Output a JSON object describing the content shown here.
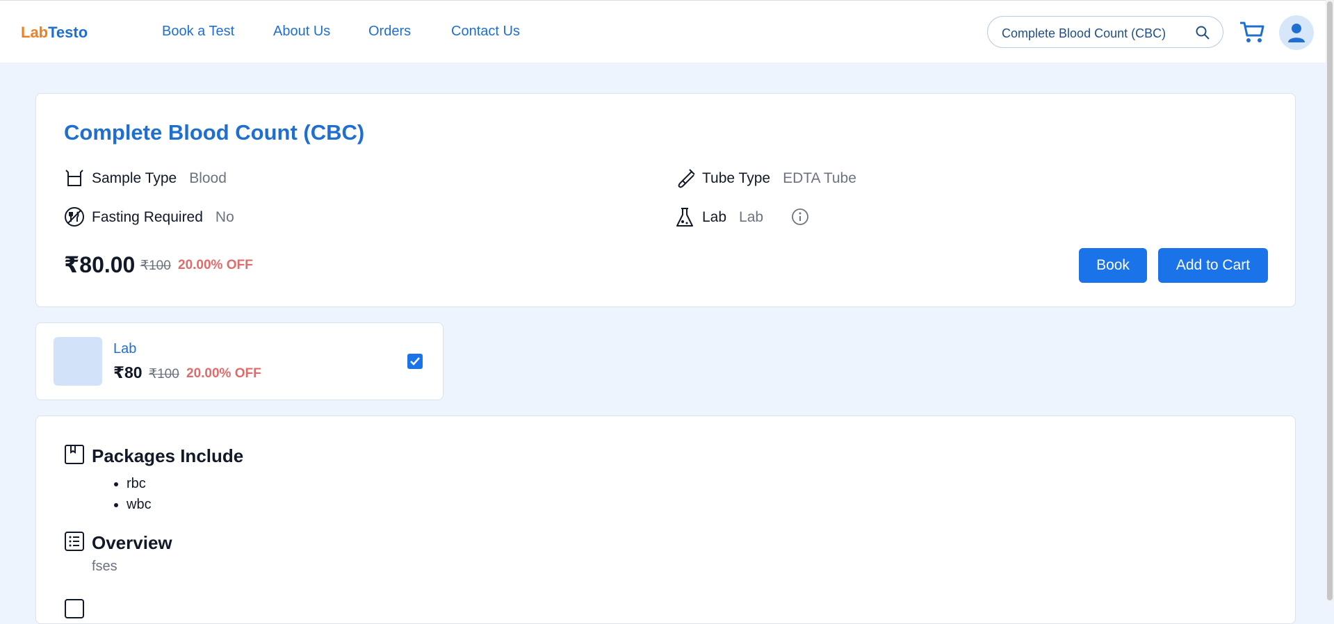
{
  "header": {
    "brand_part1": "Lab",
    "brand_part2": "Testo",
    "nav": [
      "Book a Test",
      "About Us",
      "Orders",
      "Contact Us"
    ],
    "search_value": "Complete Blood Count (CBC)",
    "icons": [
      "search-icon",
      "cart-icon",
      "user-avatar-icon"
    ]
  },
  "test": {
    "title": "Complete Blood Count (CBC)",
    "attributes": [
      {
        "key": "Sample Type",
        "value": "Blood",
        "icon": "sample-container-icon"
      },
      {
        "key": "Tube Type",
        "value": "EDTA Tube",
        "icon": "test-tube-icon"
      },
      {
        "key": "Fasting Required",
        "value": "No",
        "icon": "fasting-icon"
      },
      {
        "key": "Lab",
        "value": "Lab",
        "icon": "flask-icon"
      }
    ],
    "price": "₹80.00",
    "mrp": "₹100",
    "discount": "20.00% OFF",
    "book_label": "Book",
    "cart_label": "Add to Cart"
  },
  "lab_option": {
    "name": "Lab",
    "price": "₹80",
    "mrp": "₹100",
    "discount": "20.00% OFF",
    "selected": true
  },
  "details": {
    "packages_heading": "Packages Include",
    "packages": [
      "rbc",
      "wbc"
    ],
    "overview_heading": "Overview",
    "overview_text": "fses"
  },
  "colors": {
    "accent": "#1a73e8",
    "brand_orange": "#f07f22",
    "discount": "#e06b6b",
    "page_bg": "#eef4fd"
  }
}
